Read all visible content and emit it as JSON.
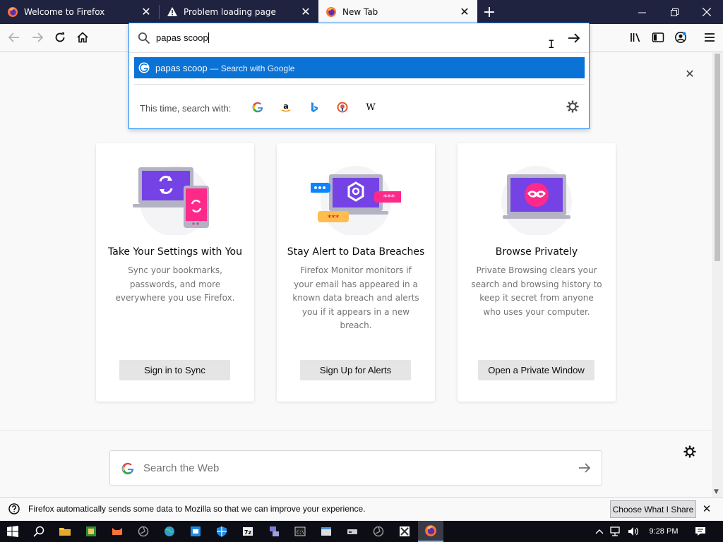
{
  "tabs": [
    {
      "title": "Welcome to Firefox",
      "icon": "firefox-icon",
      "active": false
    },
    {
      "title": "Problem loading page",
      "icon": "warning-icon",
      "active": false
    },
    {
      "title": "New Tab",
      "icon": "firefox-icon",
      "active": true
    }
  ],
  "address_bar": {
    "value": "papas scoop"
  },
  "suggestion": {
    "query": "papas scoop",
    "hint": "— Search with Google"
  },
  "one_off": {
    "label": "This time, search with:",
    "engines": [
      "Google",
      "Amazon",
      "Bing",
      "DuckDuckGo",
      "Wikipedia"
    ]
  },
  "cards": [
    {
      "title": "Take Your Settings with You",
      "description": "Sync your bookmarks, passwords, and more everywhere you use Firefox.",
      "button": "Sign in to Sync"
    },
    {
      "title": "Stay Alert to Data Breaches",
      "description": "Firefox Monitor monitors if your email has appeared in a known data breach and alerts you if it appears in a new breach.",
      "button": "Sign Up for Alerts"
    },
    {
      "title": "Browse Privately",
      "description": "Private Browsing clears your search and browsing history to keep it secret from anyone who uses your computer.",
      "button": "Open a Private Window"
    }
  ],
  "web_search": {
    "placeholder": "Search the Web"
  },
  "notification": {
    "message": "Firefox automatically sends some data to Mozilla so that we can improve your experience.",
    "button": "Choose What I Share"
  },
  "taskbar": {
    "time": "9:28 PM"
  },
  "colors": {
    "tabstrip": "#202340",
    "accent": "#0a84ff",
    "highlight": "#0b72d6",
    "purple": "#7542e5",
    "pink": "#ff298a"
  }
}
